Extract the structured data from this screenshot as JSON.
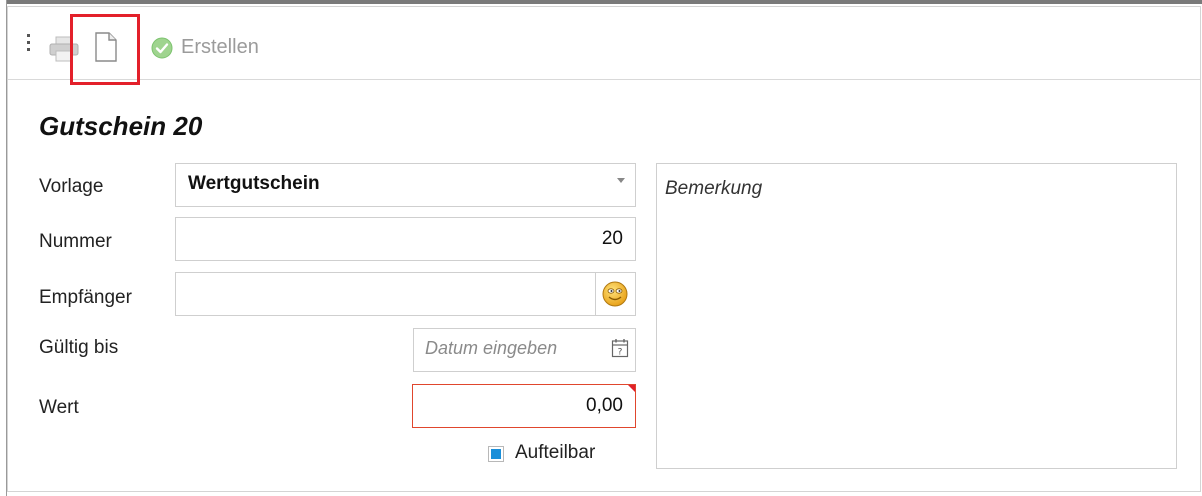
{
  "toolbar": {
    "print_icon": "printer-icon",
    "new_document_icon": "document-icon",
    "create_icon": "check-circle-icon",
    "create_label": "Erstellen"
  },
  "form": {
    "title": "Gutschein 20",
    "template": {
      "label": "Vorlage",
      "value": "Wertgutschein"
    },
    "number": {
      "label": "Nummer",
      "value": "20"
    },
    "recipient": {
      "label": "Empfänger",
      "value": "",
      "icon": "smiley-icon"
    },
    "valid_until": {
      "label": "Gültig bis",
      "placeholder": "Datum eingeben",
      "icon": "calendar-icon"
    },
    "value": {
      "label": "Wert",
      "value": "0,00"
    },
    "divisible": {
      "label": "Aufteilbar",
      "checked": true
    },
    "remark": {
      "placeholder": "Bemerkung"
    }
  },
  "colors": {
    "highlight": "#e3202a",
    "checkbox_accent": "#1a8fd9",
    "error_border": "#e0462d",
    "create_icon": "#7cc36e"
  }
}
